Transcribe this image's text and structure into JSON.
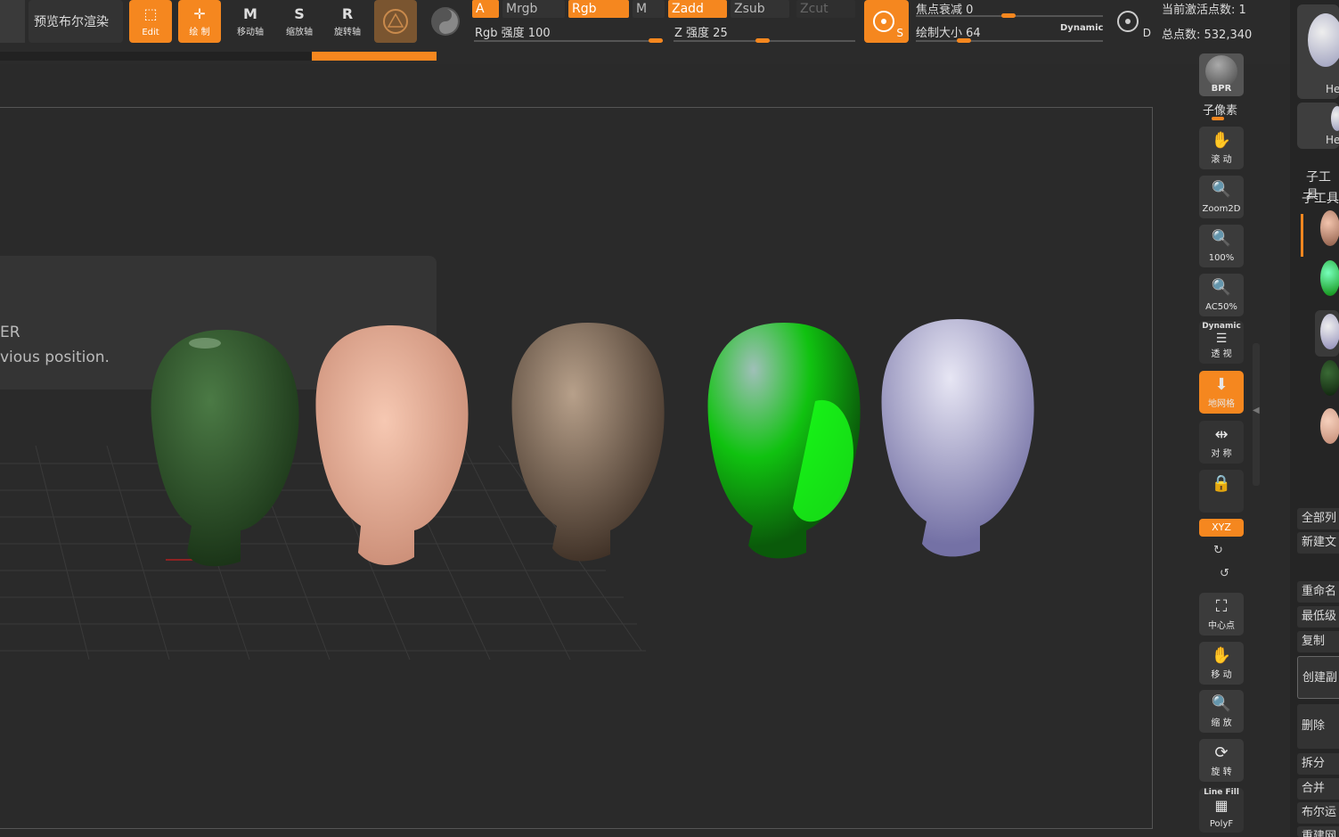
{
  "toolbar": {
    "bpr_preview": "预览布尔渲染",
    "edit": "Edit",
    "draw": "绘 制",
    "move": "移动轴",
    "scale": "缩放轴",
    "rotate": "旋转轴",
    "letters": {
      "move": "M",
      "scale": "S",
      "rotate": "R"
    }
  },
  "modes": {
    "a": "A",
    "mrgb": "Mrgb",
    "rgb": "Rgb",
    "m": "M",
    "zadd": "Zadd",
    "zsub": "Zsub",
    "zcut": "Zcut"
  },
  "sliders": {
    "rgb_intensity": "Rgb 强度 100",
    "z_intensity": "Z 强度 25",
    "focal_shift": "焦点衰减 0",
    "draw_size": "绘制大小 64",
    "dynamic": "Dynamic"
  },
  "counters": {
    "active_points": "当前激活点数: 1",
    "total_points": "总点数: 532,340"
  },
  "brush_icons": {
    "s": "S",
    "d": "D"
  },
  "canvas": {
    "overlay_text_1": "ER",
    "overlay_text_2": "vious position."
  },
  "right_toolbar": {
    "bpr": "BPR",
    "subpixel": "子像素",
    "scroll": "滚 动",
    "zoom2d": "Zoom2D",
    "zoom100": "100%",
    "ac50": "AC50%",
    "dynamic": "Dynamic",
    "perspective": "透 视",
    "floor": "地网格",
    "symmetry": "对 称",
    "xyz": "XYZ",
    "center": "中心点",
    "move": "移 动",
    "zoom": "缩 放",
    "rotate": "旋 转",
    "linefill": "Line Fill",
    "polyf": "PolyF"
  },
  "far_right": {
    "thumb_label_1": "He",
    "thumb_label_2": "He",
    "subtool_title": "子工具",
    "subtool_tab": "子工具",
    "list_all": "全部列",
    "new_doc": "新建文",
    "rename": "重命名",
    "lowest": "最低级",
    "duplicate": "复制",
    "create_copy": "创建副",
    "delete": "删除",
    "split": "拆分",
    "merge": "合并",
    "boolean": "布尔运",
    "rebuild": "重建网"
  },
  "colors": {
    "accent": "#f5871f",
    "bg": "#2a2a2a",
    "head_green_glass": "#2f5a2a",
    "head_skin": "#e9b49c",
    "head_bronze": "#8a7560",
    "head_neon_green": "#19e219",
    "head_lavender": "#a9a6cf"
  }
}
